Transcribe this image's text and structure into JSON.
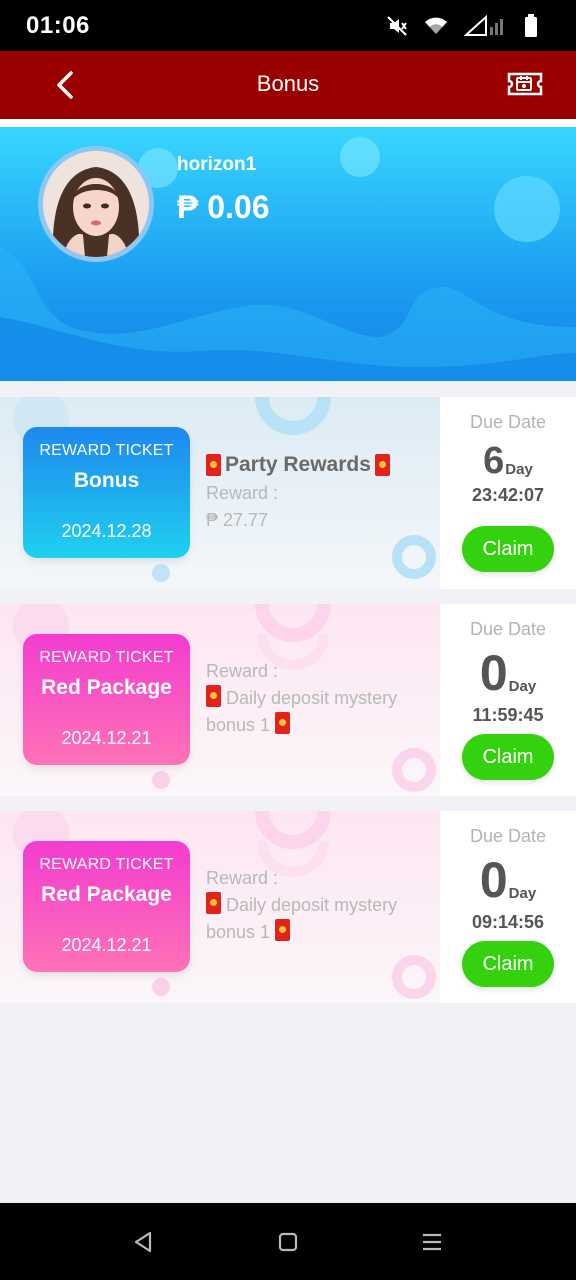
{
  "status_bar": {
    "time": "01:06",
    "icons": [
      "mute-icon",
      "wifi-icon",
      "signal-icon",
      "battery-icon"
    ]
  },
  "header": {
    "title": "Bonus",
    "back_icon": "chevron-left-icon",
    "right_icon": "ticket-icon"
  },
  "profile": {
    "username": "horizon1",
    "balance": "₱ 0.06"
  },
  "cards": [
    {
      "theme": "blue",
      "ticket_label": "REWARD TICKET",
      "ticket_name": "Bonus",
      "ticket_date": "2024.12.28",
      "title": "Party Rewards",
      "reward_label": "Reward :",
      "reward_line1": "₱ 27.77",
      "reward_line2": "",
      "due_label": "Due Date",
      "days": "6",
      "day_unit": "Day",
      "time_left": "23:42:07",
      "claim_label": "Claim"
    },
    {
      "theme": "pink",
      "ticket_label": "REWARD TICKET",
      "ticket_name": "Red Package",
      "ticket_date": "2024.12.21",
      "reward_label": "Reward :",
      "reward_line1": "Daily deposit mystery",
      "reward_line2": "bonus 1",
      "due_label": "Due Date",
      "days": "0",
      "day_unit": "Day",
      "time_left": "11:59:45",
      "claim_label": "Claim"
    },
    {
      "theme": "pink",
      "ticket_label": "REWARD TICKET",
      "ticket_name": "Red Package",
      "ticket_date": "2024.12.21",
      "reward_label": "Reward :",
      "reward_line1": "Daily deposit mystery",
      "reward_line2": "bonus 1",
      "due_label": "Due Date",
      "days": "0",
      "day_unit": "Day",
      "time_left": "09:14:56",
      "claim_label": "Claim"
    }
  ],
  "nav_bar": {
    "buttons": [
      "back-triangle-icon",
      "home-square-icon",
      "menu-lines-icon"
    ]
  },
  "colors": {
    "header": "#9a0000",
    "banner_top": "#38d6ff",
    "banner_bottom": "#1280e6",
    "claim": "#33d10e",
    "ticket_blue": "#1e88ee",
    "ticket_pink": "#f33cd0"
  }
}
